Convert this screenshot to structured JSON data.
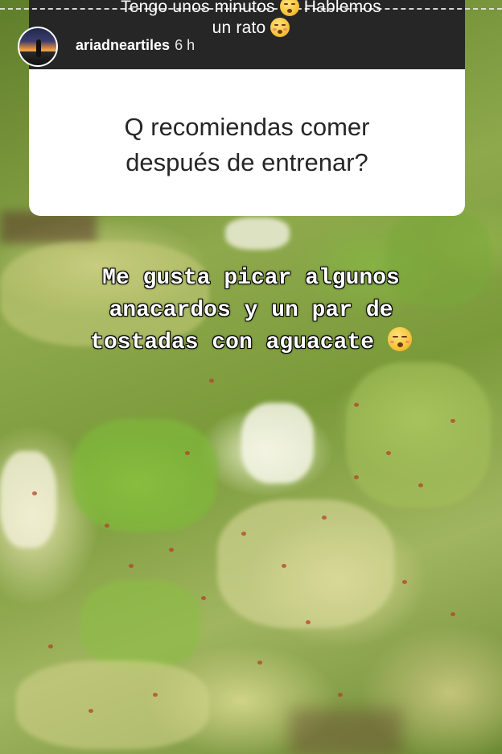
{
  "story": {
    "caption_line1": "Tengo unos minutos",
    "caption_line1_end": "Hablemos",
    "caption_line2": "un rato",
    "user": {
      "username": "ariadneartiles",
      "time": "6 h"
    }
  },
  "question_card": {
    "line1": "Q recomiendas comer",
    "line2": "después de entrenar?"
  },
  "answer": {
    "line1": "Me gusta picar algunos",
    "line2": "anacardos y un par de",
    "line3": "tostadas con aguacate"
  },
  "icons": {
    "caption_emoji_1": "grinning-sweat-emoji",
    "caption_emoji_2": "kissing-closed-eyes-emoji",
    "answer_emoji": "kissing-closed-eyes-emoji"
  },
  "colors": {
    "header_band": "#262626",
    "card_background": "#ffffff",
    "question_text": "#262626",
    "answer_text": "#ffffff"
  }
}
